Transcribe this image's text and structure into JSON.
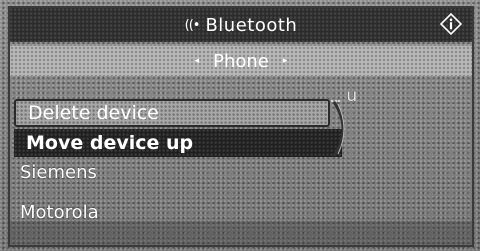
{
  "title_bar": {
    "title": "Bluetooth",
    "bt_icon_glyph": "((•",
    "info_icon": "info-icon"
  },
  "tab_bar": {
    "tab_label": "Phone",
    "left_arrow": "◂",
    "right_arrow": "▸"
  },
  "background_item_text": "u",
  "context_menu": {
    "items": [
      {
        "label": "Delete device",
        "selected": true
      },
      {
        "label": "Move device up",
        "selected": false
      }
    ]
  },
  "device_list": {
    "items": [
      {
        "label": "Siemens"
      },
      {
        "label": "Motorola"
      }
    ]
  }
}
